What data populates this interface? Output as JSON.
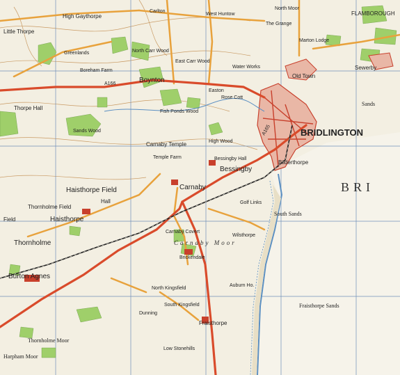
{
  "labels": {
    "high_gaythorpe": "High Gaythorpe",
    "little_thorpe": "Little Thorpe",
    "greenlands": "Greenlands",
    "boreham_farm": "Boreham Farm",
    "north_carr_wood": "North Carr Wood",
    "east_carr_wood": "East Carr Wood",
    "boynton": "Boynton",
    "easton": "Easton",
    "thorpe_hall": "Thorpe Hall",
    "sands_wood": "Sands Wood",
    "fish_ponds_wood": "Fish Ponds Wood",
    "carnaby_temple": "Carnaby Temple",
    "temple_farm": "Temple Farm",
    "bessingby": "Bessingby",
    "bessingby_hall": "Bessingby Hall",
    "high_wood": "High Wood",
    "haisthorpe_field": "Haisthorpe Field",
    "carnaby": "Carnaby",
    "hall": "Hall",
    "thornholme_field": "Thornholme Field",
    "field": "Field",
    "haisthorpe": "Haisthorpe",
    "thornholme": "Thornholme",
    "burton_agnes": "Burton Agnes",
    "thornholme_moor": "Thornholme Moor",
    "harpham_moor": "Harpham Moor",
    "carnaby_covert": "Carnaby Covert",
    "carnaby_moor": "Carnaby Moor",
    "brickendale": "Brickendale",
    "north_kingsfield": "North Kingsfield",
    "south_kingsfield": "South Kingsfield",
    "dunning": "Dunning",
    "low_stonehills": "Low Stonehills",
    "fraisthorpe": "Fraisthorpe",
    "fraisthorpe_sands": "Fraisthorpe Sands",
    "auburn": "Auburn Ho.",
    "wilsthorpe": "Wilsthorpe",
    "golf_links": "Golf Links",
    "south_sands": "South Sands",
    "bridlington": "BRIDLINGTON",
    "bridlington_bay": "BRI",
    "bilderthorpe": "Bilderthorpe",
    "old_town": "Old Town",
    "sewerby": "Sewerby",
    "flamborough": "FLAMBOROUGH",
    "marton": "Marton Lodge",
    "west_hunton": "West Huntow",
    "the_grange": "The Grange",
    "water_works": "Water Works",
    "rose_cottage": "Rose Cott",
    "carlton": "Carlton",
    "north_moor": "North Moor",
    "sands_lane": "Sands",
    "a165": "A165",
    "a166": "A166"
  },
  "colors": {
    "paper": "#f3efe2",
    "woodland": "#9fcf6a",
    "road_major": "#d94b2b",
    "road_minor": "#e8a23c",
    "railway": "#222222",
    "contour": "#c99a63",
    "grid": "#6f8fb9",
    "urban": "#c8402c",
    "water": "#5b8fc2"
  }
}
